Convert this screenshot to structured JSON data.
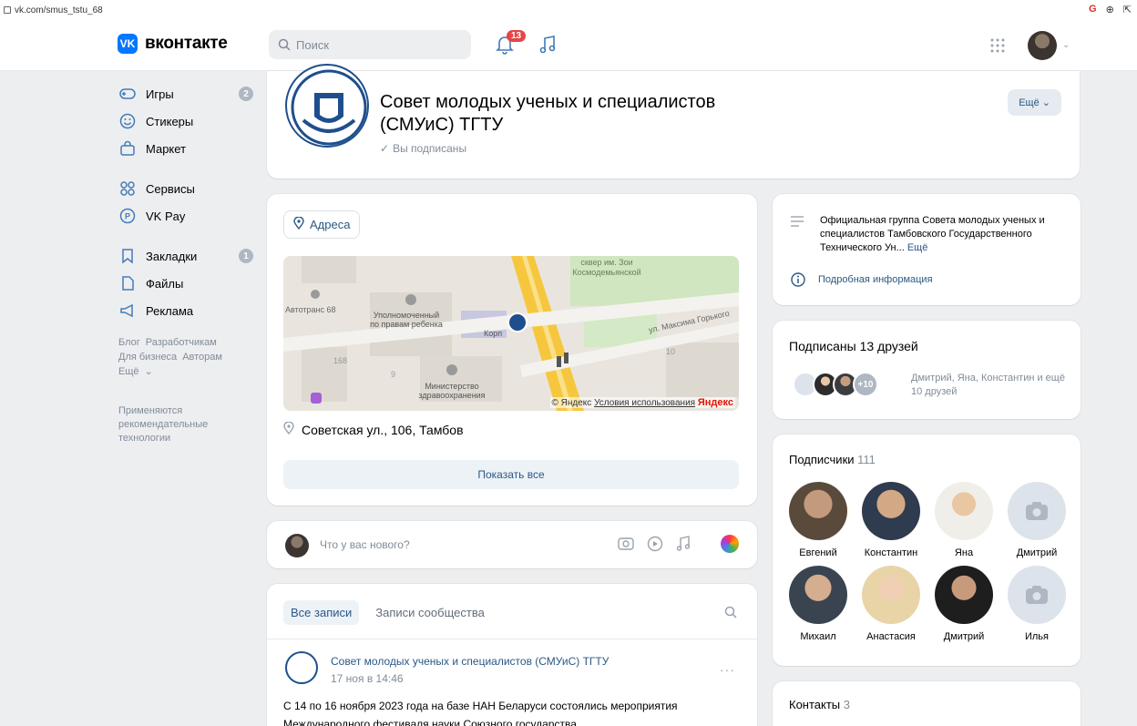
{
  "browser": {
    "url": "vk.com/smus_tstu_68"
  },
  "header": {
    "logo_text": "вконтакте",
    "search_placeholder": "Поиск",
    "notifications_count": "13"
  },
  "leftmenu": {
    "items": [
      {
        "label": "Игры",
        "badge": "2"
      },
      {
        "label": "Стикеры"
      },
      {
        "label": "Маркет"
      },
      {
        "label": "Сервисы"
      },
      {
        "label": "VK Pay"
      },
      {
        "label": "Закладки",
        "badge": "1"
      },
      {
        "label": "Файлы"
      },
      {
        "label": "Реклама"
      }
    ],
    "footer_links": [
      "Блог",
      "Разработчикам",
      "Для бизнеса",
      "Авторам",
      "Ещё"
    ],
    "recommendation_note": "Применяются рекомендательные технологии"
  },
  "group": {
    "title": "Совет молодых ученых и специалистов (СМУиС) ТГТУ",
    "subscribed_label": "Вы подписаны",
    "more_button": "Ещё"
  },
  "addresses": {
    "pill_label": "Адреса",
    "map_labels": {
      "square": "сквер им. Зои Космодемьянской",
      "autotrans": "Автотранс 68",
      "ombudsman": "Уполномоченный по правам ребенка",
      "korp": "Корп",
      "street_label": "ул. Максима Горького",
      "ministry": "Министерство здравоохранения",
      "copyright": "© Яндекс",
      "terms": "Условия использования",
      "yandex": "Яндекс",
      "num168": "168",
      "num9": "9",
      "num10": "10"
    },
    "street": "Советская ул., 106, Тамбов",
    "show_all": "Показать все"
  },
  "newpost": {
    "placeholder": "Что у вас нового?"
  },
  "wall": {
    "tab_all": "Все записи",
    "tab_community": "Записи сообщества",
    "post": {
      "author": "Совет молодых ученых и специалистов (СМУиС) ТГТУ",
      "date": "17 ноя в 14:46",
      "text": "С 14 по 16 ноября 2023 года на базе НАН Беларуси состоялись мероприятия Международного фестиваля науки Союзного государства"
    }
  },
  "description": {
    "text": "Официальная группа Совета молодых ученых и специалистов Тамбовского Государственного Технического Ун...",
    "more": "Ещё",
    "info_link": "Подробная информация"
  },
  "friends": {
    "title": "Подписаны 13 друзей",
    "extra_count": "+10",
    "names": "Дмитрий, Яна, Константин и ещё 10 друзей"
  },
  "subscribers": {
    "title": "Подписчики",
    "count": "111",
    "people": [
      {
        "name": "Евгений",
        "photo": true
      },
      {
        "name": "Константин",
        "photo": true
      },
      {
        "name": "Яна",
        "photo": true
      },
      {
        "name": "Дмитрий",
        "photo": false
      },
      {
        "name": "Михаил",
        "photo": true
      },
      {
        "name": "Анастасия",
        "photo": true
      },
      {
        "name": "Дмитрий",
        "photo": true
      },
      {
        "name": "Илья",
        "photo": false
      }
    ]
  },
  "contacts": {
    "title": "Контакты",
    "count": "3"
  },
  "colors": {
    "accent": "#0077ff",
    "link": "#2a5885",
    "badge": "#e64646",
    "bg": "#edeef0"
  }
}
